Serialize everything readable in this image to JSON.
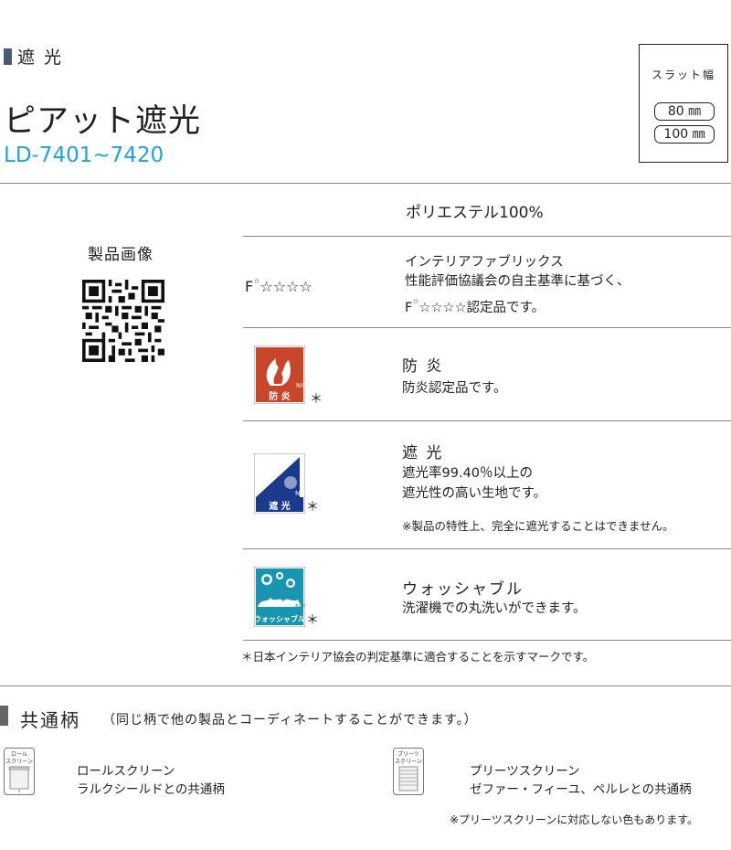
{
  "category": "遮 光",
  "product": {
    "name": "ピアット遮光",
    "code": "LD-7401~7420"
  },
  "slat": {
    "label": "スラット幅",
    "sizes": [
      "80 ㎜",
      "100 ㎜"
    ]
  },
  "product_image_label": "製品画像",
  "material": "ポリエステル100%",
  "fstar": {
    "mark": "F",
    "mark_sup": "☆",
    "stars": "☆☆☆☆",
    "lines": [
      "インテリアファブリックス",
      "性能評価協議会の自主基準に基づく、"
    ],
    "line3_suffix": "認定品です。"
  },
  "features": [
    {
      "badge_text": "防 炎",
      "title": "防 炎",
      "lines": [
        "防炎認定品です。"
      ],
      "note": ""
    },
    {
      "badge_text": "遮 光",
      "title": "遮 光",
      "lines": [
        "遮光率99.40％以上の",
        "遮光性の高い生地です。"
      ],
      "note": "※製品の特性上、完全に遮光することはできません。"
    },
    {
      "badge_text": "ウォッシャブル",
      "title": "ウォッシャブル",
      "lines": [
        "洗濯機での丸洗いができます。"
      ],
      "note": ""
    }
  ],
  "badge_brand": "NIF",
  "asterisk": "＊",
  "association_note": "＊日本インテリア協会の判定基準に適合することを示すマークです。",
  "common": {
    "title": "共通柄",
    "subtitle": "（同じ柄で他の製品とコーディネートすることができます。）",
    "items": [
      {
        "icon_label": "ロール\nスクリーン",
        "name": "ロールスクリーン",
        "detail": "ラルクシールドとの共通柄"
      },
      {
        "icon_label": "プリーツ\nスクリーン",
        "name": "プリーツスクリーン",
        "detail": "ゼファー・フィーユ、ペルレとの共通柄"
      }
    ],
    "footnote": "※プリーツスクリーンに対応しない色もあります。"
  },
  "colors": {
    "code": "#1fa3d8",
    "flame_badge": "#c8462a",
    "blackout_badge": "#1a3a8c",
    "washable_badge": "#1a95b0"
  }
}
